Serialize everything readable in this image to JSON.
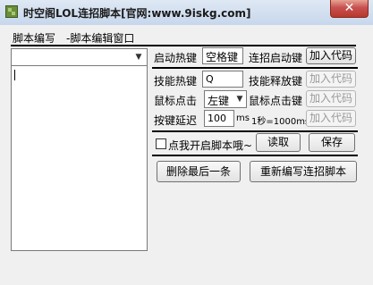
{
  "window": {
    "title": "时空阁LOL连招脚本[官网:www.9iskg.com]",
    "close_label": "✕"
  },
  "tabs": [
    {
      "label": "脚本编写"
    },
    {
      "label": "-脚本编辑窗口"
    }
  ],
  "script_editor": {
    "selected_value": ""
  },
  "start_hotkey": {
    "label": "启动热键",
    "value": "空格键",
    "combo_label": "连招启动键",
    "add_code_label": "加入代码"
  },
  "skill_hotkey": {
    "label": "技能热键",
    "value": "Q",
    "release_label": "技能释放键",
    "add_code_label": "加入代码"
  },
  "mouse_click": {
    "label": "鼠标点击",
    "selected": "左键",
    "key_label": "鼠标点击键",
    "add_code_label": "加入代码"
  },
  "key_delay": {
    "label": "按键延迟",
    "value": "100",
    "unit": "ms",
    "note": "1秒=1000ms",
    "add_code_label": "加入代码"
  },
  "script_control": {
    "checkbox_label": "点我开启脚本哦~",
    "checked": false,
    "read_label": "读取",
    "save_label": "保存"
  },
  "actions": {
    "delete_last_label": "删除最后一条",
    "rewrite_label": "重新编写连招脚本"
  },
  "colors": {
    "titlebar": "#c7d7ec",
    "close": "#c75050",
    "background": "#f0f0f0"
  }
}
